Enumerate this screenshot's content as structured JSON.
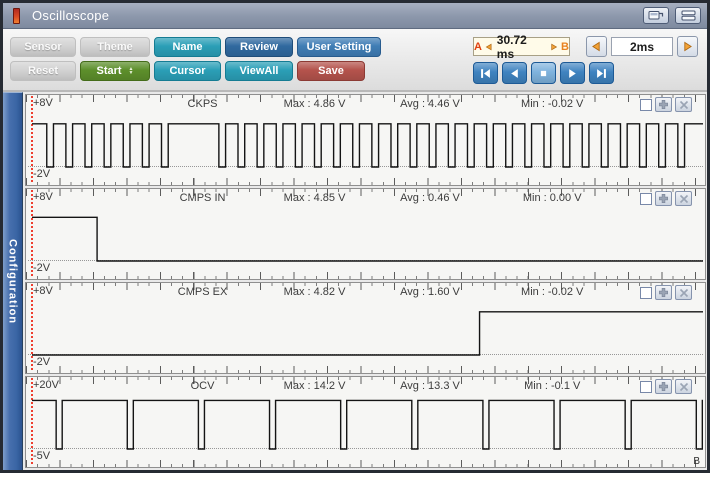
{
  "window": {
    "title": "Oscilloscope"
  },
  "titlebar_icons": [
    {
      "name": "window-icon"
    },
    {
      "name": "menu-icon"
    }
  ],
  "toolbar": {
    "rows": [
      [
        {
          "label": "Sensor",
          "style": "disabled"
        },
        {
          "label": "Theme",
          "style": "disabled"
        },
        {
          "label": "Name",
          "style": "teal"
        },
        {
          "label": "Review",
          "style": "blue-dark"
        },
        {
          "label": "User Setting",
          "style": "blue"
        }
      ],
      [
        {
          "label": "Reset",
          "style": "disabled"
        },
        {
          "label": "Start",
          "style": "green"
        },
        {
          "label": "Cursor",
          "style": "teal"
        },
        {
          "label": "ViewAll",
          "style": "teal"
        },
        {
          "label": "Save",
          "style": "red"
        }
      ]
    ],
    "start_spinner_up": "▲",
    "start_spinner_down": "▼",
    "ab_range": {
      "a": "A",
      "value": "30.72 ms",
      "b": "B"
    },
    "timebase": "2ms",
    "playback": [
      "first-frame",
      "step-back",
      "stop",
      "play",
      "last-frame"
    ]
  },
  "sidebar": {
    "tab": "Configuration"
  },
  "channels": [
    {
      "name": "CKPS",
      "range_top": "+8V",
      "range_bottom": "-2V",
      "stats": {
        "max": "Max : 4.86 V",
        "avg": "Avg : 4.46 V",
        "min": "Min : -0.02 V"
      },
      "checkbox_checked": false,
      "scale": {
        "top_v": 8,
        "bottom_v": -2
      },
      "waveform": {
        "type": "pulse_train",
        "high_v": 4.8,
        "low_v": 0,
        "start": 22,
        "pitch": 28.5,
        "width": 10,
        "count": 34,
        "skip": [
          7,
          8
        ]
      }
    },
    {
      "name": "CMPS IN",
      "range_top": "+8V",
      "range_bottom": "-2V",
      "stats": {
        "max": "Max : 4.85 V",
        "avg": "Avg : 0.46 V",
        "min": "Min : 0.00 V"
      },
      "checkbox_checked": false,
      "scale": {
        "top_v": 8,
        "bottom_v": -2
      },
      "waveform": {
        "type": "step",
        "from_v": 4.85,
        "to_v": 0,
        "edge": 97
      }
    },
    {
      "name": "CMPS EX",
      "range_top": "+8V",
      "range_bottom": "-2V",
      "stats": {
        "max": "Max : 4.82 V",
        "avg": "Avg : 1.60 V",
        "min": "Min : -0.02 V"
      },
      "checkbox_checked": false,
      "scale": {
        "top_v": 8,
        "bottom_v": -2
      },
      "waveform": {
        "type": "step",
        "from_v": 0,
        "to_v": 4.8,
        "edge": 667
      }
    },
    {
      "name": "OCV",
      "range_top": "+20V",
      "range_bottom": "-5V",
      "stats": {
        "max": "Max : 14.2 V",
        "avg": "Avg : 13.3 V",
        "min": "Min : -0.1 V"
      },
      "checkbox_checked": false,
      "scale": {
        "top_v": 20,
        "bottom_v": -5
      },
      "waveform": {
        "type": "pulse_train",
        "high_v": 13.5,
        "low_v": 0,
        "start": 36,
        "pitch": 106,
        "width": 9,
        "count": 10,
        "skip": []
      }
    }
  ],
  "corner_marker": "B",
  "colors": {
    "frame": "#262b33",
    "titlebar_text": "#ffffff",
    "accent_teal": "#2b9fb7",
    "accent_blue": "#30699f",
    "accent_blue_light": "#3f7db5",
    "accent_green": "#5d8f2b",
    "accent_red": "#b4534c",
    "disabled_gray": "#d3d3d3",
    "playback_blue": "#3f83c0",
    "arrow_orange": "#f2a238",
    "marker_red": "#e04010",
    "marker_orange": "#e8821e",
    "panel_bg": "#f6f6f4",
    "wave": "#141414",
    "ab_box_bg": "#fffbe9"
  }
}
